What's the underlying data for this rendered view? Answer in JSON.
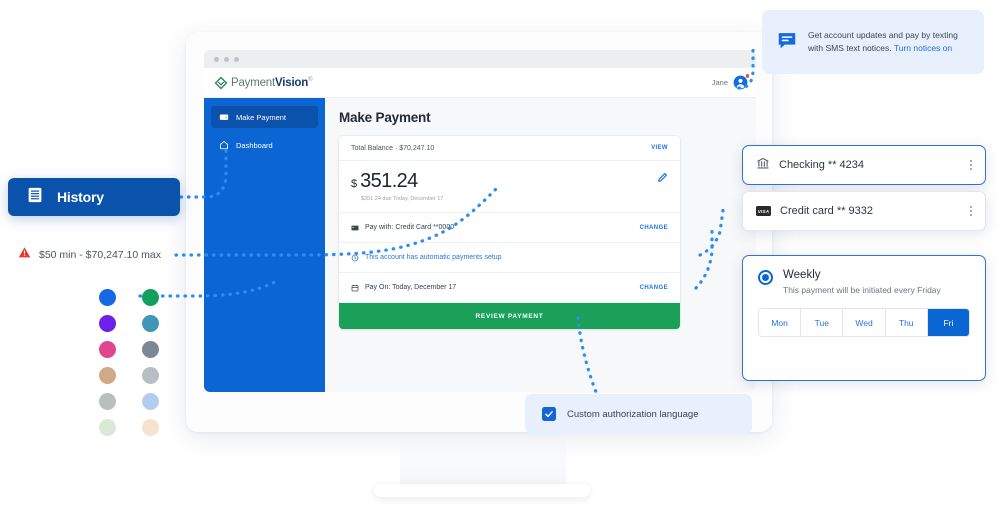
{
  "brand": {
    "logo_part1": "Payment",
    "logo_part2": "Vision",
    "logo_tm": "®",
    "accent_blue": "#0b66d3",
    "deep_blue": "#0b52ad",
    "green": "#1aa058",
    "link_blue": "#1a73e8"
  },
  "browser": {
    "dots_count": 3
  },
  "header": {
    "user_name": "Jane",
    "avatar_icon": "user-avatar-icon",
    "notification_badge": true
  },
  "sidebar": {
    "items": [
      {
        "label": "Make Payment",
        "icon": "payment-card-icon",
        "active": true
      },
      {
        "label": "Dashboard",
        "icon": "home-icon",
        "active": false
      }
    ]
  },
  "main": {
    "page_title": "Make Payment",
    "balance": {
      "label": "Total Balance · $70,247.10",
      "view_link": "VIEW"
    },
    "amount": {
      "currency": "$",
      "value": "351.24",
      "due_text": "$351.24 due Today, December 17",
      "edit_icon": "pencil-icon"
    },
    "pay_with": {
      "icon": "credit-card-icon",
      "label": "Pay with: Credit Card **0000",
      "change_link": "CHANGE"
    },
    "autopay_notice": {
      "icon": "clock-icon",
      "label": "This account has automatic payments setup"
    },
    "pay_on": {
      "icon": "calendar-icon",
      "label": "Pay On: Today, December 17",
      "change_link": "CHANGE"
    },
    "review_button": "REVIEW PAYMENT"
  },
  "callouts": {
    "sms": {
      "icon": "chat-bubble-icon",
      "text": "Get account updates and pay by texting with SMS text notices.",
      "link": "Turn notices on"
    },
    "accounts": [
      {
        "icon": "bank-icon",
        "label": "Checking ** 4234",
        "selected": true,
        "menu_icon": "kebab-menu-icon"
      },
      {
        "icon": "visa-card-icon",
        "label": "Credit card ** 9332",
        "selected": false,
        "menu_icon": "kebab-menu-icon"
      }
    ],
    "schedule": {
      "radio_icon": "radio-selected-icon",
      "title": "Weekly",
      "subtitle": "This payment will be initiated every Friday",
      "days": [
        {
          "label": "Mon",
          "selected": false
        },
        {
          "label": "Tue",
          "selected": false
        },
        {
          "label": "Wed",
          "selected": false
        },
        {
          "label": "Thu",
          "selected": false
        },
        {
          "label": "Fri",
          "selected": true
        }
      ]
    },
    "authorization": {
      "checkbox_icon": "checkbox-checked-icon",
      "label": "Custom authorization language"
    }
  },
  "annotations": {
    "history": {
      "icon": "history-list-icon",
      "label": "History"
    },
    "minmax": {
      "icon": "warning-triangle-icon",
      "label": "$50 min - $70,247.10 max"
    },
    "swatches": [
      "#1668e3",
      "#12a05c",
      "#6b21e8",
      "#3f96b8",
      "#e0468f",
      "#7d8796",
      "#ceaa86",
      "#b8bec4",
      "#b7c0bb",
      "#b3cdee",
      "#dbe8d6",
      "#f6e3cf"
    ]
  }
}
